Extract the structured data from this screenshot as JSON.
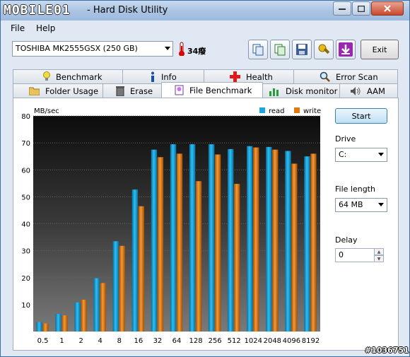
{
  "window": {
    "logo_text": "MOBILE01",
    "title": "- Hard Disk Utility"
  },
  "menu": {
    "file": "File",
    "help": "Help"
  },
  "toolbar": {
    "drive": "TOSHIBA MK2555GSX (250 GB)",
    "temperature": "34癈",
    "exit_label": "Exit"
  },
  "tabs": {
    "row1": [
      "Benchmark",
      "Info",
      "Health",
      "Error Scan"
    ],
    "row2": [
      "Folder Usage",
      "Erase",
      "File Benchmark",
      "Disk monitor",
      "AAM"
    ],
    "active": "File Benchmark"
  },
  "side": {
    "start_label": "Start",
    "drive_label": "Drive",
    "drive_value": "C:",
    "file_length_label": "File length",
    "file_length_value": "64 MB",
    "delay_label": "Delay",
    "delay_value": "0"
  },
  "watermark": "#1036751",
  "colors": {
    "read": "#1aa6e0",
    "write": "#e07a10",
    "accent": "#3b6ea5"
  },
  "chart_data": {
    "type": "bar",
    "ylabel": "MB/sec",
    "ylim": [
      0,
      80
    ],
    "yticks": [
      10,
      20,
      30,
      40,
      50,
      60,
      70,
      80
    ],
    "categories": [
      "0.5",
      "1",
      "2",
      "4",
      "8",
      "16",
      "32",
      "64",
      "128",
      "256",
      "512",
      "1024",
      "2048",
      "4096",
      "8192"
    ],
    "series": [
      {
        "name": "read",
        "values": [
          3.5,
          6.5,
          10.8,
          19.8,
          33.5,
          52.7,
          67.5,
          69.5,
          69.5,
          69.5,
          67.7,
          68.8,
          68.5,
          67.0,
          65.0
        ]
      },
      {
        "name": "write",
        "values": [
          3.0,
          6.0,
          11.8,
          18.0,
          31.8,
          46.5,
          64.7,
          66.0,
          55.8,
          65.7,
          54.8,
          68.3,
          67.5,
          62.3,
          66.0
        ]
      }
    ],
    "legend_position": "top-right",
    "grid": true
  }
}
